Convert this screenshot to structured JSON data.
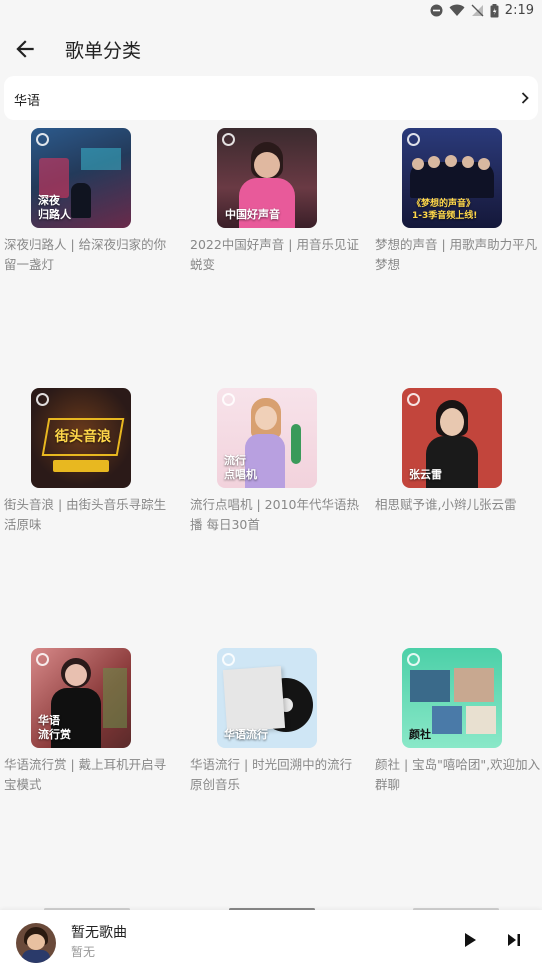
{
  "status": {
    "time": "2:19"
  },
  "header": {
    "title": "歌单分类"
  },
  "category": {
    "label": "华语"
  },
  "playlists": [
    {
      "cover_text": "深夜\n归路人",
      "caption": "深夜归路人 | 给深夜归家的你留一盏灯"
    },
    {
      "cover_text": "中国好声音",
      "caption": "2022中国好声音 | 用音乐见证蜕变"
    },
    {
      "cover_text": "《梦想的声音》\n1-3季音频上线!",
      "caption": "梦想的声音 | 用歌声助力平凡梦想"
    },
    {
      "cover_text": "街头音浪",
      "caption": "街头音浪 | 由街头音乐寻踪生活原味"
    },
    {
      "cover_text": "流行\n点唱机",
      "caption": "流行点唱机 | 2010年代华语热播 每日30首"
    },
    {
      "cover_text": "张云雷",
      "caption": "相思赋予谁,小辫儿张云雷"
    },
    {
      "cover_text": "华语\n流行赏",
      "caption": "华语流行赏 | 戴上耳机开启寻宝模式"
    },
    {
      "cover_text": "华语流行",
      "caption": "华语流行 | 时光回溯中的流行原创音乐"
    },
    {
      "cover_text": "颜社",
      "caption": "颜社 | 宝岛\"嘻哈团\",欢迎加入群聊"
    }
  ],
  "player": {
    "song": "暂无歌曲",
    "artist": "暂无"
  },
  "colors": {
    "cover1": "#233a5a",
    "cover2": "#5a2f3a",
    "cover3": "#1f2552",
    "cover4": "#2b1a18",
    "cover5": "#f2d2dc",
    "cover6": "#c2453c",
    "cover7": "#8a3a3a",
    "cover8": "#cfe6f5",
    "cover9": "#4cd0a8"
  }
}
